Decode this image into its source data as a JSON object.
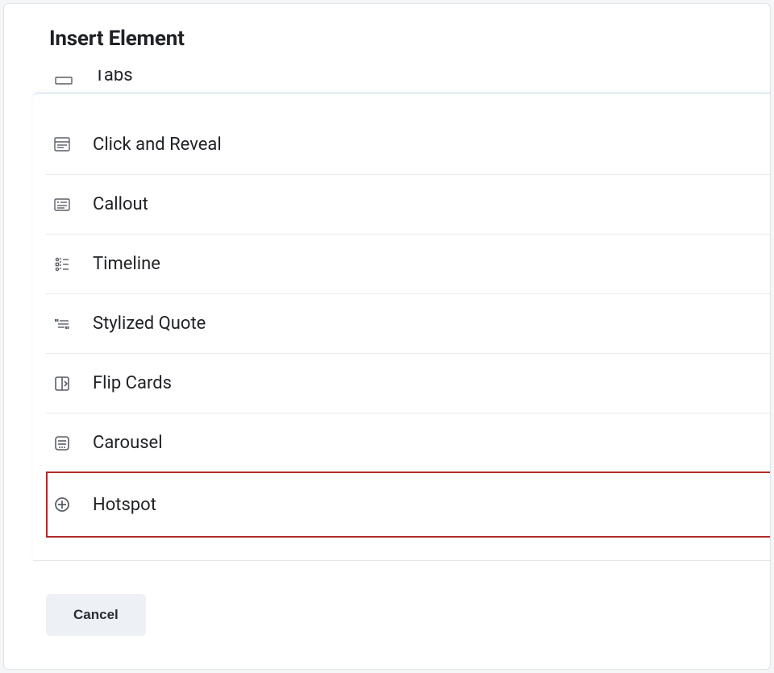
{
  "header": {
    "title": "Insert Element"
  },
  "truncated_item": {
    "label": "Tabs",
    "icon": "tabs-icon"
  },
  "items": [
    {
      "label": "Click and Reveal",
      "icon": "click-reveal-icon",
      "highlighted": false
    },
    {
      "label": "Callout",
      "icon": "callout-icon",
      "highlighted": false
    },
    {
      "label": "Timeline",
      "icon": "timeline-icon",
      "highlighted": false
    },
    {
      "label": "Stylized Quote",
      "icon": "quote-icon",
      "highlighted": false
    },
    {
      "label": "Flip Cards",
      "icon": "flip-cards-icon",
      "highlighted": false
    },
    {
      "label": "Carousel",
      "icon": "carousel-icon",
      "highlighted": false
    },
    {
      "label": "Hotspot",
      "icon": "hotspot-icon",
      "highlighted": true
    }
  ],
  "footer": {
    "cancel_label": "Cancel"
  }
}
